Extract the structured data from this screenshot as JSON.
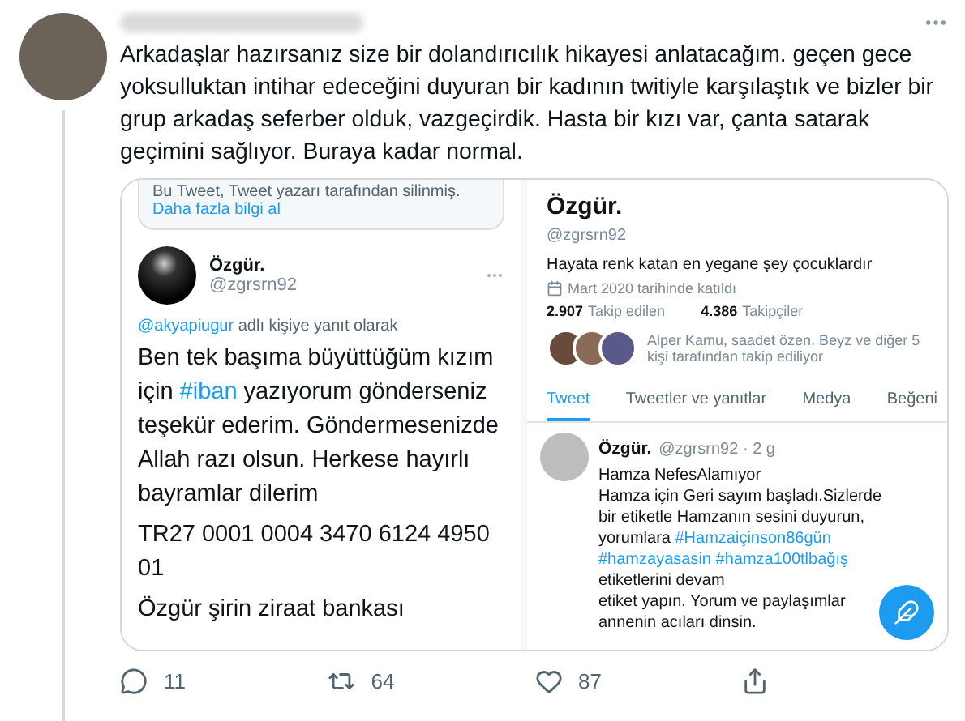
{
  "tweet": {
    "body": "Arkadaşlar hazırsanız size bir dolandırıcılık hikayesi anlatacağım. geçen gece yoksulluktan intihar edeceğini duyuran bir kadının twitiyle karşılaştık ve bizler bir grup arkadaş seferber olduk, vazgeçirdik. Hasta bir kızı var, çanta satarak geçimini sağlıyor. Buraya kadar normal."
  },
  "embedded": {
    "left": {
      "notice": "Bu Tweet, Tweet yazarı tarafından silinmiş.",
      "notice_link": "Daha fazla bilgi al",
      "author": {
        "name": "Özgür.",
        "handle": "@zgrsrn92"
      },
      "reply_to": {
        "mention": "@akyapiugur",
        "text": "adlı kişiye yanıt olarak"
      },
      "paragraphs": [
        [
          {
            "kind": "text",
            "text": "Ben tek başıma büyüttüğüm kızım için "
          },
          {
            "kind": "hashtag",
            "text": "#iban"
          },
          {
            "kind": "text",
            "text": " yazıyorum gönderseniz teşekür ederim. Göndermesenizde Allah razı olsun. Herkese hayırlı bayramlar dilerim"
          }
        ],
        [
          {
            "kind": "text",
            "text": "TR27 0001 0004 3470 6124 4950 01"
          }
        ],
        [
          {
            "kind": "text",
            "text": "Özgür şirin ziraat bankası"
          }
        ]
      ]
    },
    "right": {
      "name": "Özgür.",
      "handle": "@zgrsrn92",
      "bio": "Hayata renk katan en yegane şey çocuklardır",
      "joined": "Mart 2020 tarihinde katıldı",
      "stats": [
        {
          "value": "2.907",
          "label": "Takip edilen"
        },
        {
          "value": "4.386",
          "label": "Takipçiler"
        }
      ],
      "followed_by": "Alper Kamu, saadet özen, Beyz ve diğer 5 kişi tarafından takip ediliyor",
      "tabs": [
        {
          "label": "Tweet",
          "selected": true
        },
        {
          "label": "Tweetler ve yanıtlar",
          "selected": false
        },
        {
          "label": "Medya",
          "selected": false
        },
        {
          "label": "Beğeni",
          "selected": false
        }
      ],
      "post": {
        "name": "Özgür.",
        "meta": "@zgrsrn92 · 2 g",
        "body": [
          {
            "kind": "text",
            "text": "Hamza NefesAlamıyor"
          },
          {
            "kind": "break"
          },
          {
            "kind": "text",
            "text": "Hamza için Geri sayım başladı.Sizlerde bir etiketle Hamzanın sesini duyurun, yorumlara "
          },
          {
            "kind": "hashtag",
            "text": "#Hamzaiçinson86gün"
          },
          {
            "kind": "space"
          },
          {
            "kind": "hashtag",
            "text": "#hamzayasasin"
          },
          {
            "kind": "space"
          },
          {
            "kind": "hashtag",
            "text": "#hamza100tlbağış"
          },
          {
            "kind": "text",
            "text": " etiketlerini devam"
          },
          {
            "kind": "break"
          },
          {
            "kind": "text",
            "text": "etiket yapın. Yorum ve paylaşımlar"
          },
          {
            "kind": "break"
          },
          {
            "kind": "text",
            "text": "annenin acıları dinsin."
          }
        ]
      }
    }
  },
  "actions": [
    {
      "kind": "reply",
      "count": "11"
    },
    {
      "kind": "retweet",
      "count": "64"
    },
    {
      "kind": "like",
      "count": "87"
    },
    {
      "kind": "share"
    }
  ]
}
